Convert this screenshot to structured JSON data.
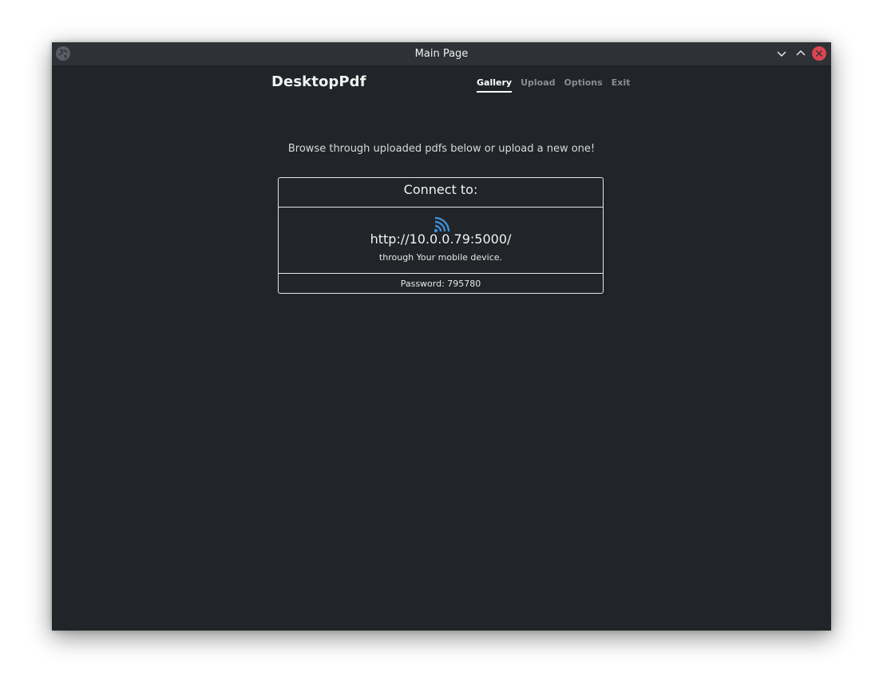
{
  "window": {
    "title": "Main Page"
  },
  "header": {
    "brand": "DesktopPdf",
    "nav": [
      {
        "label": "Gallery",
        "active": true
      },
      {
        "label": "Upload",
        "active": false
      },
      {
        "label": "Options",
        "active": false
      },
      {
        "label": "Exit",
        "active": false
      }
    ]
  },
  "main": {
    "subtitle": "Browse through uploaded pdfs below or upload a new one!",
    "connect": {
      "heading": "Connect to:",
      "icon": "wifi-icon",
      "url": "http://10.0.0.79:5000/",
      "device_note": "through Your mobile device.",
      "password": "Password: 795780"
    }
  },
  "colors": {
    "background": "#212428",
    "titlebar": "#2e3136",
    "close_button": "#da4453",
    "wifi_icon": "#3d8fd6",
    "nav_active": "#ffffff",
    "nav_inactive": "#8a8d91"
  }
}
